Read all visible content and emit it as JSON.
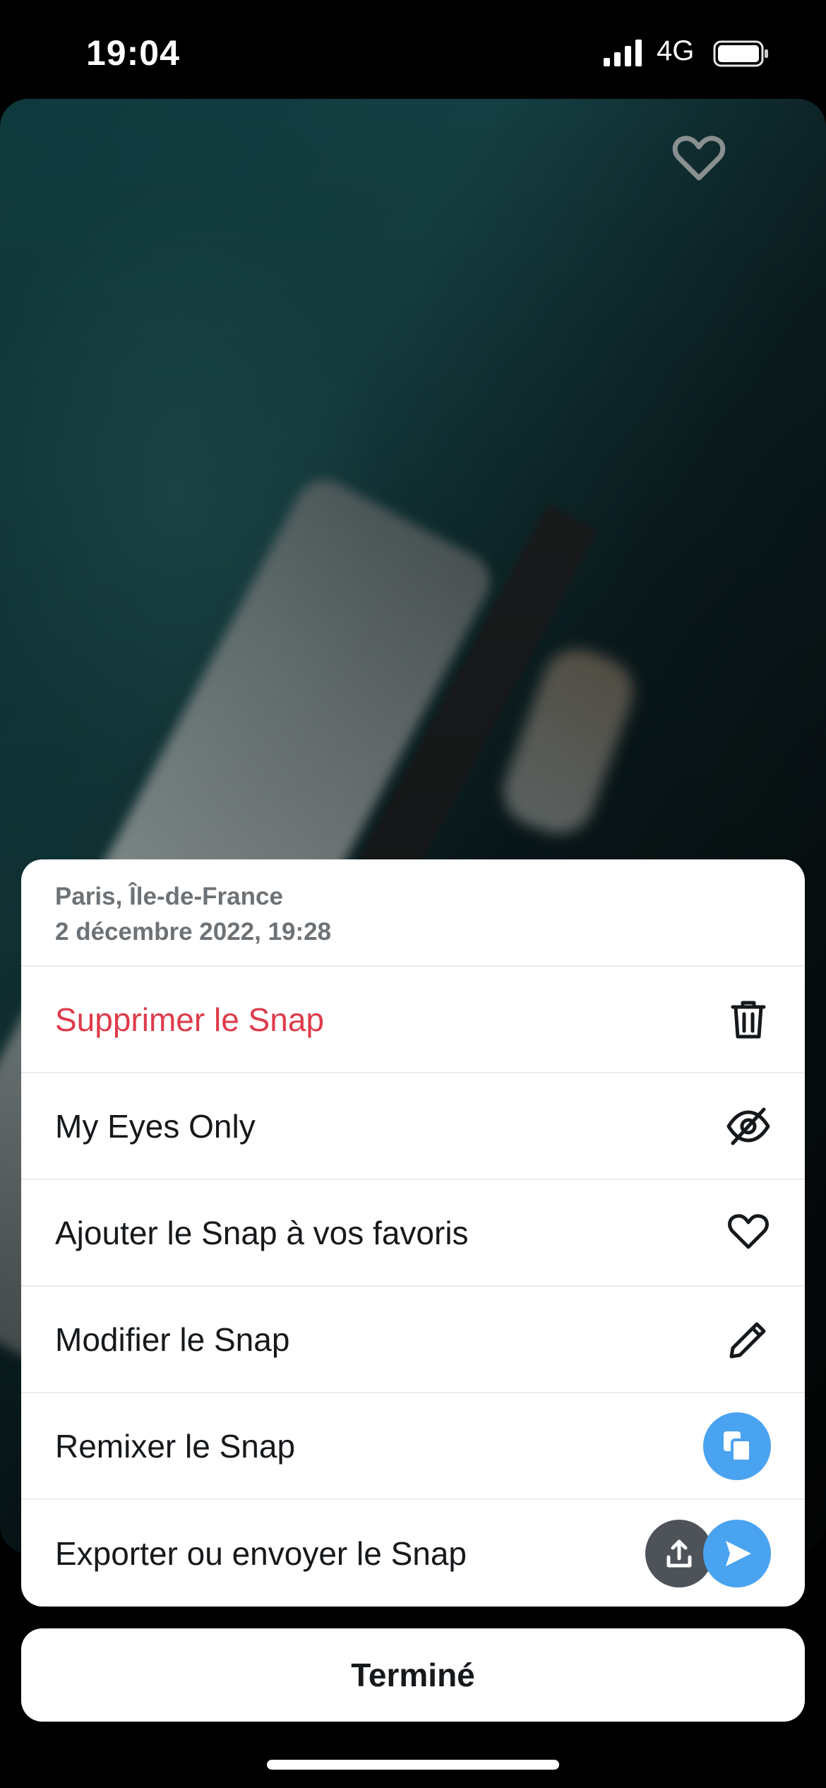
{
  "status_bar": {
    "time": "19:04",
    "network": "4G"
  },
  "sheet": {
    "location": "Paris, Île-de-France",
    "date": "2 décembre 2022, 19:28",
    "actions": [
      {
        "label": "Supprimer le Snap",
        "icon": "trash-icon",
        "color": "#de3c4b"
      },
      {
        "label": "My Eyes Only",
        "icon": "eye-slash-icon"
      },
      {
        "label": "Ajouter le Snap à vos favoris",
        "icon": "heart-icon"
      },
      {
        "label": "Modifier le Snap",
        "icon": "pencil-icon"
      },
      {
        "label": "Remixer le Snap",
        "icon": "remix-icon",
        "color": "#4aa3f0"
      },
      {
        "label": "Exporter ou envoyer le Snap",
        "icon": "export-icon"
      }
    ]
  },
  "done_label": "Terminé",
  "colors": {
    "danger": "#de3c4b",
    "accent_blue": "#4aa3f0",
    "export_gray": "#4d5358"
  }
}
